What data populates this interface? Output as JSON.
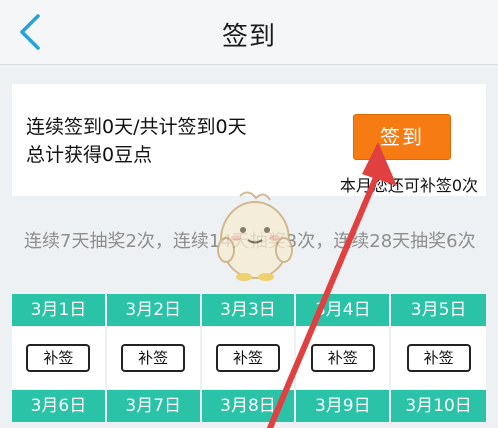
{
  "header": {
    "title": "签到",
    "back_icon": "chevron-left-icon"
  },
  "summary": {
    "line1": "连续签到0天/共计签到0天",
    "line2": "总计获得0豆点",
    "checkin_button": "签到",
    "makeup_info": "本月您还可补签0次"
  },
  "lottery": {
    "text": "连续7天抽奖2次，连续14天抽奖3次，连续28天抽奖6次"
  },
  "calendar": {
    "row1_dates": [
      "3月1日",
      "3月2日",
      "3月3日",
      "3月4日",
      "3月5日"
    ],
    "makeup_label": "补签",
    "row2_dates": [
      "3月6日",
      "3月7日",
      "3月8日",
      "3月9日",
      "3月10日"
    ]
  },
  "colors": {
    "accent_orange": "#f57b12",
    "calendar_teal": "#2bc3a8",
    "back_blue": "#27a2d8",
    "annotation_red": "#e04040"
  }
}
